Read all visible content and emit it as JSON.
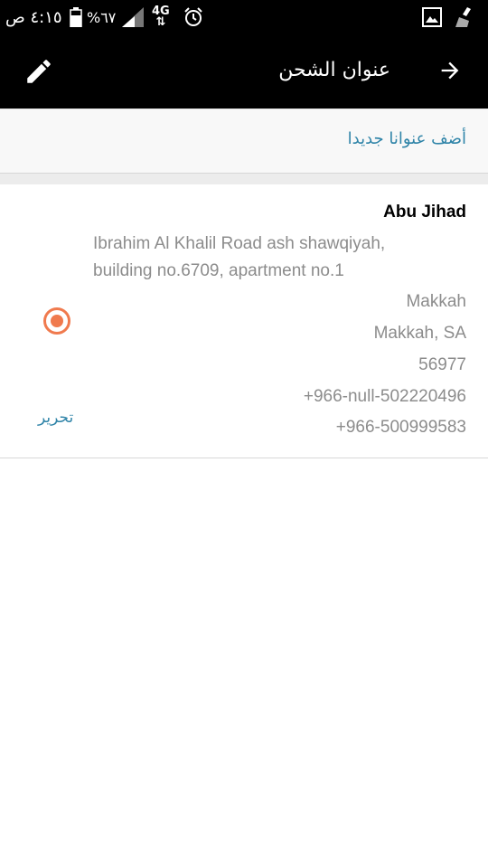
{
  "status_bar": {
    "time": "٤:١٥ ص",
    "battery_percent": "%٦٧",
    "network": "4G",
    "icons": [
      "battery-icon",
      "signal-icon",
      "alarm-icon",
      "gallery-icon",
      "clean-icon"
    ]
  },
  "app_bar": {
    "title": "عنوان الشحن",
    "edit_icon": "pencil-icon",
    "back_icon": "arrow-right-icon"
  },
  "add_address": {
    "label": "أضف عنوانا جديدا"
  },
  "address": {
    "name": "Abu Jihad",
    "street_line1": "Ibrahim Al Khalil Road ash shawqiyah,",
    "street_line2": "building no.6709, apartment no.1",
    "city": "Makkah",
    "region": "Makkah, SA",
    "postal_code": "56977",
    "phone1": "+966-null-502220496",
    "phone2": "+966-500999583",
    "selected": true,
    "edit_label": "تحرير"
  },
  "colors": {
    "accent": "#f07a4e",
    "link": "#2f84a8",
    "app_bar": "#000000"
  }
}
